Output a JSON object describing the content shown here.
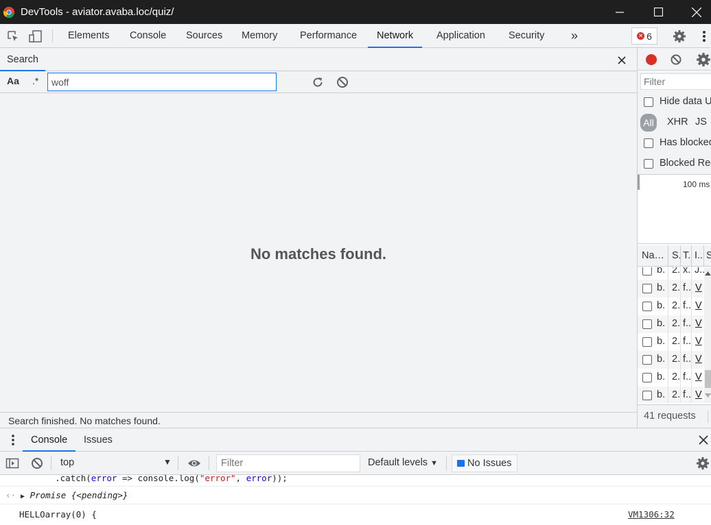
{
  "window": {
    "title": "DevTools - aviator.avaba.loc/quiz/"
  },
  "main_tabs": [
    "Elements",
    "Console",
    "Sources",
    "Memory",
    "Performance",
    "Network",
    "Application",
    "Security"
  ],
  "active_tab": "Network",
  "more_tabs": "»",
  "error_count": "6",
  "search": {
    "tab_label": "Search",
    "case_label": "Aa",
    "regex_label": ".*",
    "query": "woff",
    "empty_message": "No matches found.",
    "status": "Search finished.  No matches found."
  },
  "network": {
    "filter_placeholder": "Filter",
    "hide_data_label": "Hide data U",
    "types": [
      "All",
      "XHR",
      "JS"
    ],
    "has_blocked_label": "Has blocked",
    "blocked_requests_label": "Blocked Req",
    "overview_tick": "100 ms",
    "columns": [
      "Na…",
      "S.",
      "T.",
      "I..",
      "S"
    ],
    "rows": [
      {
        "name": "b.",
        "status": "2.",
        "type": "x.",
        "initiator": "J.."
      },
      {
        "name": "b.",
        "status": "2.",
        "type": "f..",
        "initiator": "V"
      },
      {
        "name": "b.",
        "status": "2.",
        "type": "f..",
        "initiator": "V"
      },
      {
        "name": "b.",
        "status": "2.",
        "type": "f..",
        "initiator": "V"
      },
      {
        "name": "b.",
        "status": "2.",
        "type": "f..",
        "initiator": "V"
      },
      {
        "name": "b.",
        "status": "2.",
        "type": "f..",
        "initiator": "V"
      },
      {
        "name": "b.",
        "status": "2.",
        "type": "f..",
        "initiator": "V"
      },
      {
        "name": "b.",
        "status": "2.",
        "type": "f..",
        "initiator": "V"
      }
    ],
    "requests_summary": "41 requests"
  },
  "drawer": {
    "tabs": [
      "Console",
      "Issues"
    ],
    "active": "Console",
    "context": "top",
    "filter_placeholder": "Filter",
    "levels": "Default levels",
    "issues_button": "No Issues"
  },
  "console": {
    "line1_prefix": "    .catch(",
    "line1_param": "error",
    "line1_arrow": " => console.log(",
    "line1_string": "\"error\"",
    "line1_comma": ", ",
    "line1_param2": "error",
    "line1_suffix": "));",
    "promise_label": "Promise",
    "promise_state": "{<pending>}",
    "log_text": "HELLOarray(0) {",
    "log_source": "VM1306:32"
  },
  "colors": {
    "accent": "#1a73e8",
    "error": "#d93025",
    "record": "#d93025"
  }
}
